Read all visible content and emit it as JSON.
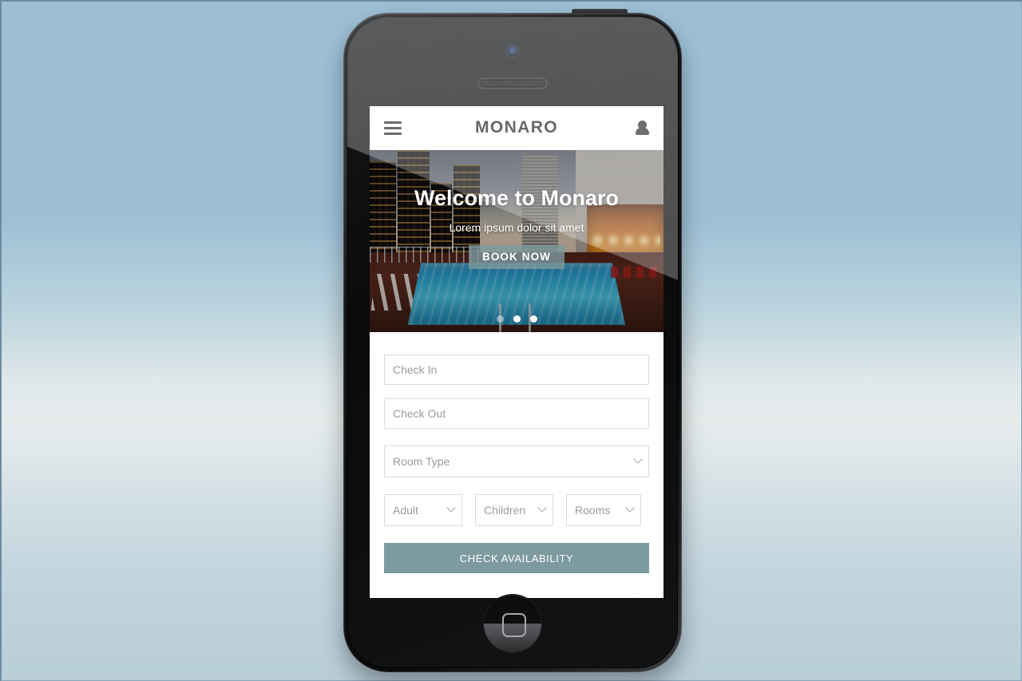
{
  "device": {
    "type": "smartphone-mockup",
    "camera_icon": "camera-icon",
    "speaker_icon": "speaker-grille-icon",
    "home_button_icon": "home-button-icon",
    "power_button": "power-button",
    "volume_up_button": "volume-up-button",
    "volume_down_button": "volume-down-button",
    "silent_switch": "silent-switch"
  },
  "header": {
    "title": "MONARO",
    "menu_icon": "hamburger-menu-icon",
    "account_icon": "user-account-icon"
  },
  "hero": {
    "title": "Welcome to Monaro",
    "subtitle": "Lorem ipsum dolor sit amet",
    "cta_label": "BOOK NOW",
    "cta_color": "#7c989e",
    "carousel": {
      "total": 3,
      "active_index": 0,
      "slides": [
        "1",
        "2",
        "3"
      ]
    }
  },
  "booking": {
    "check_in": {
      "placeholder": "Check In",
      "value": ""
    },
    "check_out": {
      "placeholder": "Check Out",
      "value": ""
    },
    "room_type": {
      "label": "Room Type",
      "selected": "Room Type",
      "options": [
        "Room Type"
      ],
      "chevron_icon": "chevron-down-icon"
    },
    "adult": {
      "label": "Adult",
      "selected": "Adult",
      "options": [
        "Adult"
      ],
      "chevron_icon": "chevron-down-icon"
    },
    "children": {
      "label": "Children",
      "selected": "Children",
      "options": [
        "Children"
      ],
      "chevron_icon": "chevron-down-icon"
    },
    "rooms": {
      "label": "Rooms",
      "selected": "Rooms",
      "options": [
        "Rooms"
      ],
      "chevron_icon": "chevron-down-icon"
    },
    "submit_label": "CHECK AVAILABILITY",
    "submit_color": "#7d9aa0"
  }
}
